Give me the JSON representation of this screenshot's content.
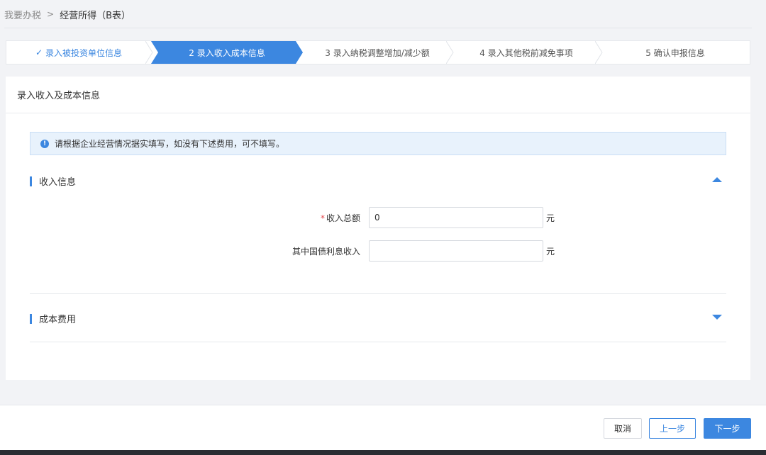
{
  "breadcrumb": {
    "root": "我要办税",
    "separator": ">",
    "current": "经营所得（B表）"
  },
  "steps": [
    {
      "label": "录入被投资单位信息",
      "status": "done",
      "check": "✓"
    },
    {
      "label": "2 录入收入成本信息",
      "status": "active"
    },
    {
      "label": "3 录入纳税调整增加/减少额",
      "status": "pending"
    },
    {
      "label": "4 录入其他税前减免事项",
      "status": "pending"
    },
    {
      "label": "5 确认申报信息",
      "status": "pending"
    }
  ],
  "panel": {
    "title": "录入收入及成本信息",
    "notice": "请根据企业经营情况据实填写，如没有下述费用，可不填写。",
    "income_section": {
      "title": "收入信息",
      "fields": [
        {
          "label": "收入总额",
          "required_mark": "*",
          "value": "0",
          "unit": "元"
        },
        {
          "label": "其中国债利息收入",
          "value": "",
          "unit": "元"
        }
      ]
    },
    "cost_section": {
      "title": "成本费用"
    }
  },
  "footer": {
    "cancel_label": "取消",
    "prev_label": "上一步",
    "next_label": "下一步"
  },
  "colors": {
    "accent": "#3c87e0",
    "required": "#e5484d"
  }
}
